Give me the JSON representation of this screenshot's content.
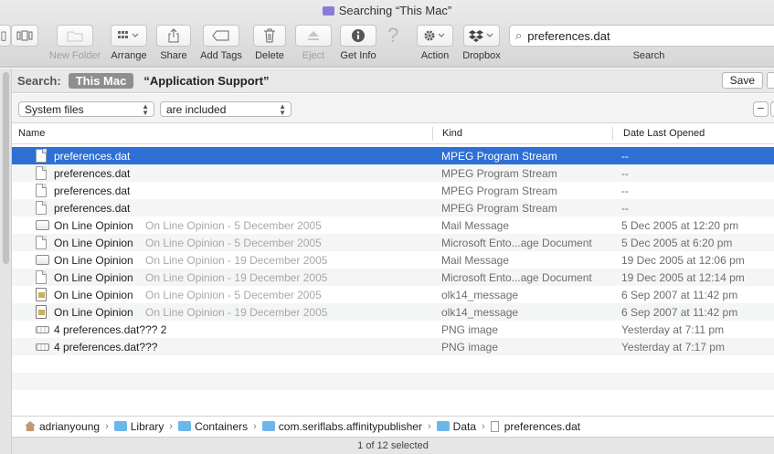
{
  "window": {
    "title": "Searching “This Mac”"
  },
  "toolbar": {
    "buttons": [
      {
        "id": "new-folder",
        "label": "New Folder",
        "icon": "new-folder-icon",
        "enabled": false
      },
      {
        "id": "arrange",
        "label": "Arrange",
        "icon": "grid-icon",
        "enabled": true
      },
      {
        "id": "share",
        "label": "Share",
        "icon": "share-icon",
        "enabled": true
      },
      {
        "id": "add-tags",
        "label": "Add Tags",
        "icon": "tag-icon",
        "enabled": true
      },
      {
        "id": "delete",
        "label": "Delete",
        "icon": "trash-icon",
        "enabled": true
      },
      {
        "id": "eject",
        "label": "Eject",
        "icon": "eject-icon",
        "enabled": false
      },
      {
        "id": "get-info",
        "label": "Get Info",
        "icon": "info-icon",
        "enabled": true
      },
      {
        "id": "action",
        "label": "Action",
        "icon": "gear-icon",
        "enabled": true
      },
      {
        "id": "dropbox",
        "label": "Dropbox",
        "icon": "dropbox-icon",
        "enabled": true
      }
    ],
    "search": {
      "value": "preferences.dat",
      "label": "Search"
    }
  },
  "scope": {
    "label": "Search:",
    "this_mac": "This Mac",
    "app_support": "“Application Support”",
    "save": "Save"
  },
  "criteria": {
    "attribute": "System files",
    "condition": "are included"
  },
  "columns": {
    "name": "Name",
    "kind": "Kind",
    "date": "Date Last Opened"
  },
  "files": [
    {
      "icon": "doc",
      "name": "preferences.dat",
      "sub": "",
      "kind": "MPEG Program Stream",
      "date": "--",
      "selected": true
    },
    {
      "icon": "doc",
      "name": "preferences.dat",
      "sub": "",
      "kind": "MPEG Program Stream",
      "date": "--"
    },
    {
      "icon": "doc",
      "name": "preferences.dat",
      "sub": "",
      "kind": "MPEG Program Stream",
      "date": "--"
    },
    {
      "icon": "doc",
      "name": "preferences.dat",
      "sub": "",
      "kind": "MPEG Program Stream",
      "date": "--"
    },
    {
      "icon": "mail",
      "name": "On Line Opinion",
      "sub": "On Line Opinion - 5 December 2005",
      "kind": "Mail Message",
      "date": "5 Dec 2005 at 12:20 pm"
    },
    {
      "icon": "doc",
      "name": "On Line Opinion",
      "sub": "On Line Opinion - 5 December 2005",
      "kind": "Microsoft Ento...age Document",
      "date": "5 Dec 2005 at 6:20 pm"
    },
    {
      "icon": "mail",
      "name": "On Line Opinion",
      "sub": "On Line Opinion - 19 December 2005",
      "kind": "Mail Message",
      "date": "19 Dec 2005 at 12:06 pm"
    },
    {
      "icon": "doc",
      "name": "On Line Opinion",
      "sub": "On Line Opinion - 19 December 2005",
      "kind": "Microsoft Ento...age Document",
      "date": "19 Dec 2005 at 12:14 pm"
    },
    {
      "icon": "olk",
      "name": "On Line Opinion",
      "sub": "On Line Opinion - 5 December 2005",
      "kind": "olk14_message",
      "date": "6 Sep 2007 at 11:42 pm"
    },
    {
      "icon": "olk",
      "name": "On Line Opinion",
      "sub": "On Line Opinion - 19 December 2005",
      "kind": "olk14_message",
      "date": "6 Sep 2007 at 11:42 pm"
    },
    {
      "icon": "png",
      "name": "4 preferences.dat??? 2",
      "sub": "",
      "kind": "PNG image",
      "date": "Yesterday at 7:11 pm"
    },
    {
      "icon": "png",
      "name": "4 preferences.dat???",
      "sub": "",
      "kind": "PNG image",
      "date": "Yesterday at 7:17 pm"
    }
  ],
  "path": [
    {
      "type": "home",
      "label": "adrianyoung"
    },
    {
      "type": "folder",
      "label": "Library"
    },
    {
      "type": "folder",
      "label": "Containers"
    },
    {
      "type": "folder",
      "label": "com.seriflabs.affinitypublisher"
    },
    {
      "type": "folder",
      "label": "Data"
    },
    {
      "type": "doc",
      "label": "preferences.dat"
    }
  ],
  "status": "1 of 12 selected"
}
